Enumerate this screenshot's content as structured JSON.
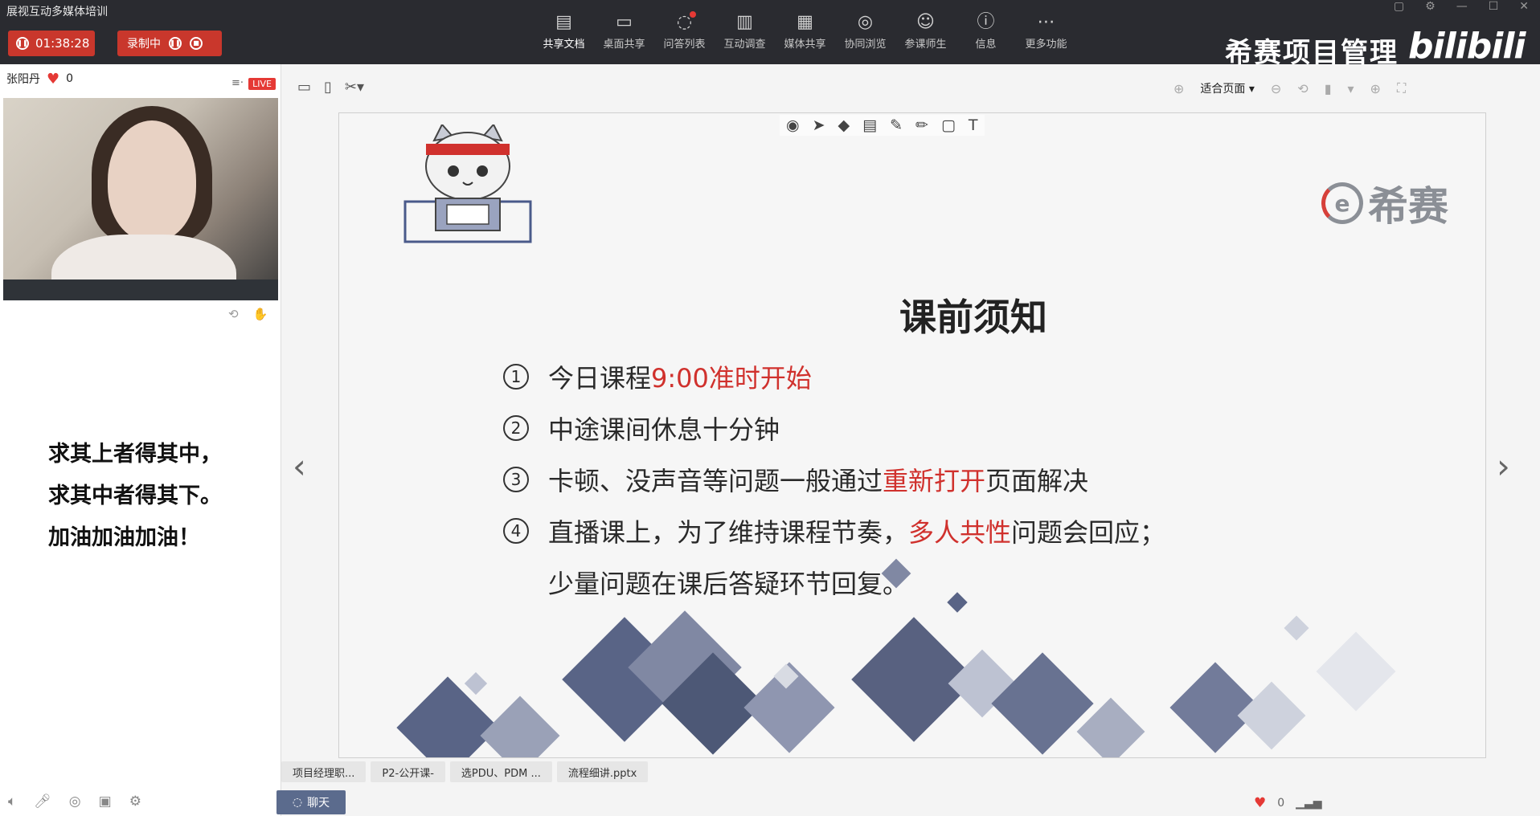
{
  "app": {
    "title": "展视互动多媒体培训",
    "timer": "01:38:28",
    "recording_label": "录制中"
  },
  "toolbar": {
    "items": [
      {
        "label": "共享文档",
        "icon": "document-icon"
      },
      {
        "label": "桌面共享",
        "icon": "desktop-share-icon"
      },
      {
        "label": "问答列表",
        "icon": "qa-icon"
      },
      {
        "label": "互动调查",
        "icon": "bar-chart-icon"
      },
      {
        "label": "媒体共享",
        "icon": "film-icon"
      },
      {
        "label": "协同浏览",
        "icon": "compass-icon"
      },
      {
        "label": "参课师生",
        "icon": "users-icon"
      },
      {
        "label": "信息",
        "icon": "info-icon"
      },
      {
        "label": "更多功能",
        "icon": "more-icon"
      }
    ]
  },
  "brand": {
    "name": "希赛项目管理",
    "watermark": "bilibili"
  },
  "presenter": {
    "name": "张阳丹",
    "likes": "0",
    "live_badge": "LIVE"
  },
  "motto": {
    "line1": "求其上者得其中，",
    "line2": "求其中者得其下。",
    "line3": "加油加油加油！"
  },
  "slide_toolbar": {
    "fit_label": "适合页面"
  },
  "slide": {
    "logo_text": "希赛",
    "title": "课前须知",
    "items": [
      {
        "num": "①",
        "text_a": "今日课程",
        "highlight": "9:00准时开始",
        "text_b": ""
      },
      {
        "num": "②",
        "text_a": "中途课间休息十分钟",
        "highlight": "",
        "text_b": ""
      },
      {
        "num": "③",
        "text_a": "卡顿、没声音等问题一般通过",
        "highlight": "重新打开",
        "text_b": "页面解决"
      },
      {
        "num": "④",
        "text_a": "直播课上，为了维持课程节奏，",
        "highlight": "多人共性",
        "text_b": "问题会回应；"
      }
    ],
    "continuation": "少量问题在课后答疑环节回复。",
    "accent_color": "#d0312d"
  },
  "file_tabs": [
    "项目经理职...",
    "P2-公开课-",
    "选PDU、PDM ...",
    "流程细讲.pptx"
  ],
  "bottom": {
    "chat_label": "聊天",
    "likes": "0"
  }
}
